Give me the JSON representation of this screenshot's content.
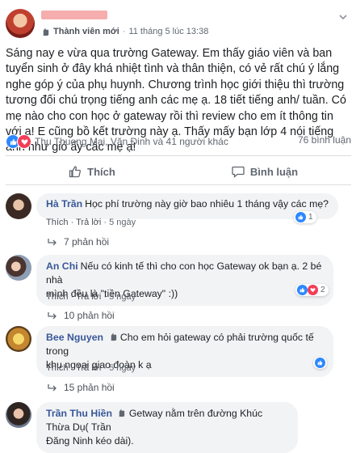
{
  "post": {
    "member_label": "Thành viên mới",
    "timestamp": "11 tháng 5 lúc 13:38",
    "separator": "·",
    "text": "Sáng nay e vừa qua trường Gateway. Em thấy giáo viên và ban tuyển sinh ở đây khá nhiệt tình và thân thiện, có vẻ rất chú ý lắng nghe góp ý của phụ huynh. Chương trình học giới thiệu thì trường tương đối chú trọng tiếng anh các mẹ ạ. 18 tiết tiếng anh/ tuần. Có mẹ nào cho con học ở gateway rồi thì review cho em ít thông tin với ạ! E cũng bồ kết trường này ạ. Thấy mấy bạn lớp 4 nói tiếng anh như gió ấy các mẹ ạ!",
    "reaction_names": "Thu Thuong Mai, Văn Đinh và 41 người khác",
    "comment_count": "76 bình luận",
    "like_label": "Thích",
    "comment_label": "Bình luận"
  },
  "comments": [
    {
      "author": "Hà Trần",
      "text": "Học phí trường này giờ bao nhiêu 1 tháng vậy các mẹ?",
      "like": "Thích",
      "reply": "Trả lời",
      "time": "5 ngày",
      "reaction_count": "1",
      "replies": "7 phản hồi"
    },
    {
      "author": "An Chi",
      "text_line1": "Nếu có kinh tế thì cho con học Gateway ok bạn ạ. 2 bé nhà",
      "text_line2": "mình đều là \"tiền Gateway\" :))",
      "like": "Thích",
      "reply": "Trả lời",
      "time": "5 ngày",
      "reaction_count": "2",
      "replies": "10 phản hồi"
    },
    {
      "author": "Bee Nguyen",
      "text_line1": "Cho em hỏi gateway có phải trường quốc tế trong",
      "text_line2": "khu ngoại giao đoàn k ạ",
      "like": "Thích",
      "reply": "Trả lời",
      "time": "5 ngày",
      "reaction_count": "",
      "replies": "15 phản hồi"
    },
    {
      "author": "Trần Thu Hiền",
      "text_line1": "Getway nằm trên đường Khúc Thừa Dụ( Trần",
      "text_line2": "Đăng Ninh kéo dài)."
    }
  ],
  "colors": {
    "accent": "#385898",
    "like_blue": "#2d88ff",
    "love_red": "#f33e58",
    "bubble_bg": "#f2f3f5"
  }
}
